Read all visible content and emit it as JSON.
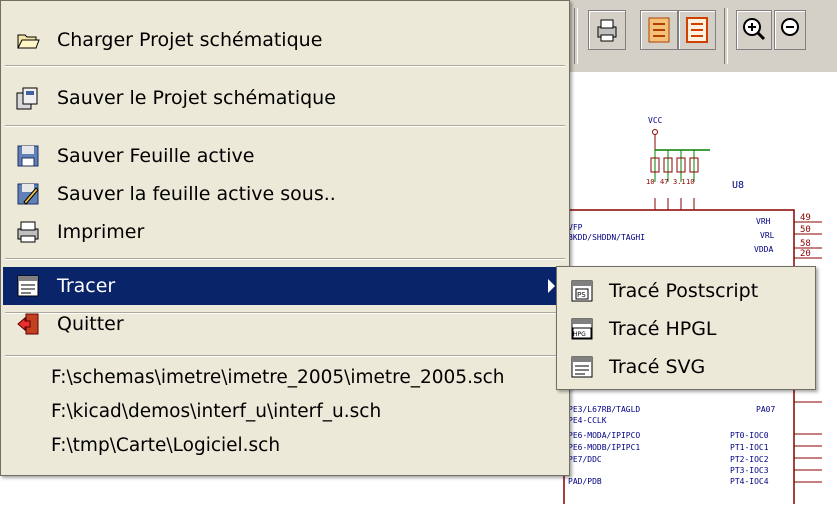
{
  "menu": {
    "items": [
      {
        "label": "Charger Projet schématique",
        "icon": "folder-open-icon"
      },
      {
        "label": "Sauver le Projet schématique",
        "icon": "save-project-icon"
      },
      {
        "label": "Sauver Feuille active",
        "icon": "floppy-disk-icon"
      },
      {
        "label": "Sauver la feuille active sous..",
        "icon": "save-as-icon"
      },
      {
        "label": "Imprimer",
        "icon": "printer-icon"
      },
      {
        "label": "Tracer",
        "icon": "plot-icon"
      },
      {
        "label": "Quitter",
        "icon": "exit-icon"
      }
    ],
    "recent_files": [
      "F:\\schemas\\imetre\\imetre_2005\\imetre_2005.sch",
      "F:\\kicad\\demos\\interf_u\\interf_u.sch",
      "F:\\tmp\\Carte\\Logiciel.sch"
    ],
    "highlight_color": "#0a246a"
  },
  "submenu": {
    "items": [
      {
        "label": "Tracé Postscript",
        "icon": "plot-postscript-icon"
      },
      {
        "label": "Tracé HPGL",
        "icon": "plot-hpgl-icon"
      },
      {
        "label": "Tracé  SVG",
        "icon": "plot-svg-icon"
      }
    ]
  },
  "schematic": {
    "labels": {
      "vcc": "VCC",
      "ref": "U8",
      "pin_left_1": "VFP",
      "pin_left_2": "BKDD/SHDDN/TAGHI",
      "pin_right_1": "VRH",
      "pin_right_2": "VRL",
      "pin_right_3": "VDDA",
      "res_1": "10",
      "res_2": "47",
      "res_3": "3.1",
      "res_4": "10",
      "pin_num_1": "49",
      "pin_num_2": "50",
      "pin_num_3": "58",
      "pin_num_4": "20",
      "row_1": "PE3/L67RB/TAGLD",
      "row_1r": "PA07",
      "row_2": "PE4-CCLK",
      "row_3": "PE6-MODA/IPIPCO",
      "row_3r": "PT0-IOC0",
      "row_4": "PE6-MODB/IPIPC1",
      "row_4r": "PT1-IOC1",
      "row_5": "PE7/DDC",
      "row_5r": "PT2-IOC2",
      "row_6r": "PT3-IOC3",
      "row_7": "PAD/PDB",
      "row_7r": "PT4-IOC4"
    }
  }
}
